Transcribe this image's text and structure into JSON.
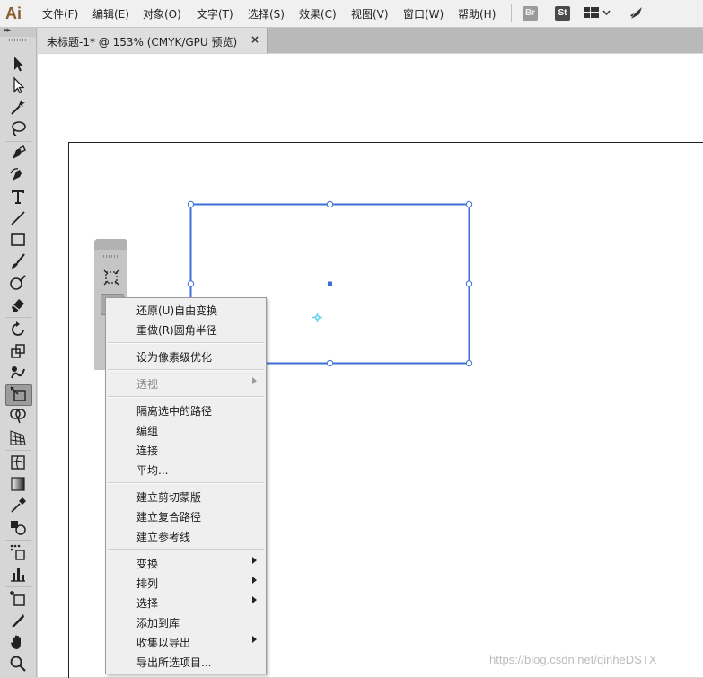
{
  "app": {
    "logo": "Ai"
  },
  "menubar": {
    "items": [
      {
        "label": "文件(F)"
      },
      {
        "label": "编辑(E)"
      },
      {
        "label": "对象(O)"
      },
      {
        "label": "文字(T)"
      },
      {
        "label": "选择(S)"
      },
      {
        "label": "效果(C)"
      },
      {
        "label": "视图(V)"
      },
      {
        "label": "窗口(W)"
      },
      {
        "label": "帮助(H)"
      }
    ],
    "bridge_badge": "Br",
    "stock_badge": "St"
  },
  "document_tab": {
    "title": "未标题-1* @ 153% (CMYK/GPU 预览)",
    "close": "×"
  },
  "tools": [
    "selection-tool",
    "direct-selection-tool",
    "magic-wand-tool",
    "lasso-tool",
    "pen-tool",
    "curvature-tool",
    "type-tool",
    "line-segment-tool",
    "rectangle-tool",
    "paintbrush-tool",
    "shaper-tool",
    "eraser-tool",
    "rotate-tool",
    "scale-tool",
    "warp-tool",
    "free-transform-tool",
    "shape-builder-tool",
    "perspective-grid-tool",
    "mesh-tool",
    "gradient-tool",
    "eyedropper-tool",
    "blend-tool",
    "symbol-sprayer-tool",
    "column-graph-tool",
    "artboard-tool",
    "slice-tool",
    "hand-tool",
    "zoom-tool"
  ],
  "active_tool": "free-transform-tool",
  "context_menu": {
    "groups": [
      [
        {
          "label": "还原(U)自由变换"
        },
        {
          "label": "重做(R)圆角半径"
        }
      ],
      [
        {
          "label": "设为像素级优化"
        }
      ],
      [
        {
          "label": "透视",
          "disabled": true,
          "submenu": true
        }
      ],
      [
        {
          "label": "隔离选中的路径"
        },
        {
          "label": "编组"
        },
        {
          "label": "连接"
        },
        {
          "label": "平均..."
        }
      ],
      [
        {
          "label": "建立剪切蒙版"
        },
        {
          "label": "建立复合路径"
        },
        {
          "label": "建立参考线"
        }
      ],
      [
        {
          "label": "变换",
          "submenu": true
        },
        {
          "label": "排列",
          "submenu": true
        },
        {
          "label": "选择",
          "submenu": true
        },
        {
          "label": "添加到库"
        },
        {
          "label": "收集以导出",
          "submenu": true
        },
        {
          "label": "导出所选项目..."
        }
      ]
    ]
  },
  "watermark": "https://blog.csdn.net/qinheDSTX",
  "colors": {
    "selection": "#3b6fd6",
    "center_point": "#5bd4e8",
    "ai_brand": "#8c5a2b"
  }
}
